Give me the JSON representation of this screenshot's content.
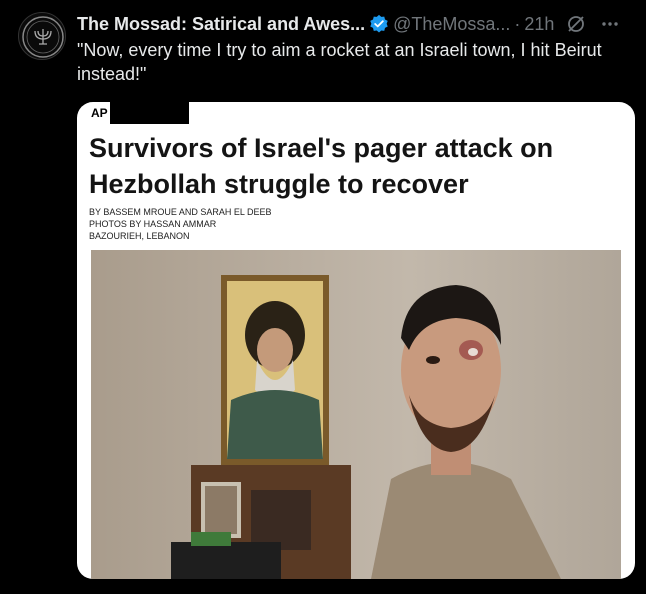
{
  "tweet": {
    "display_name": "The Mossad: Satirical and Awes...",
    "handle": "@TheMossa...",
    "separator": "·",
    "time": "21h",
    "text": "\"Now, every time I try to aim a rocket at an Israeli town, I hit Beirut instead!\""
  },
  "card": {
    "logo_text": "AP",
    "headline": "Survivors of Israel's pager attack on Hezbollah struggle to recover",
    "byline": [
      "By BASSEM MROUE and SARAH EL DEEB",
      "Photos by HASSAN AMMAR",
      "BAZOURIEH, Lebanon"
    ]
  },
  "colors": {
    "background": "#000000",
    "text_primary": "#e7e9ea",
    "text_secondary": "#71767b",
    "verified_blue": "#1d9bf0"
  },
  "icons": [
    "verified-badge-icon",
    "grok-icon",
    "more-icon"
  ]
}
